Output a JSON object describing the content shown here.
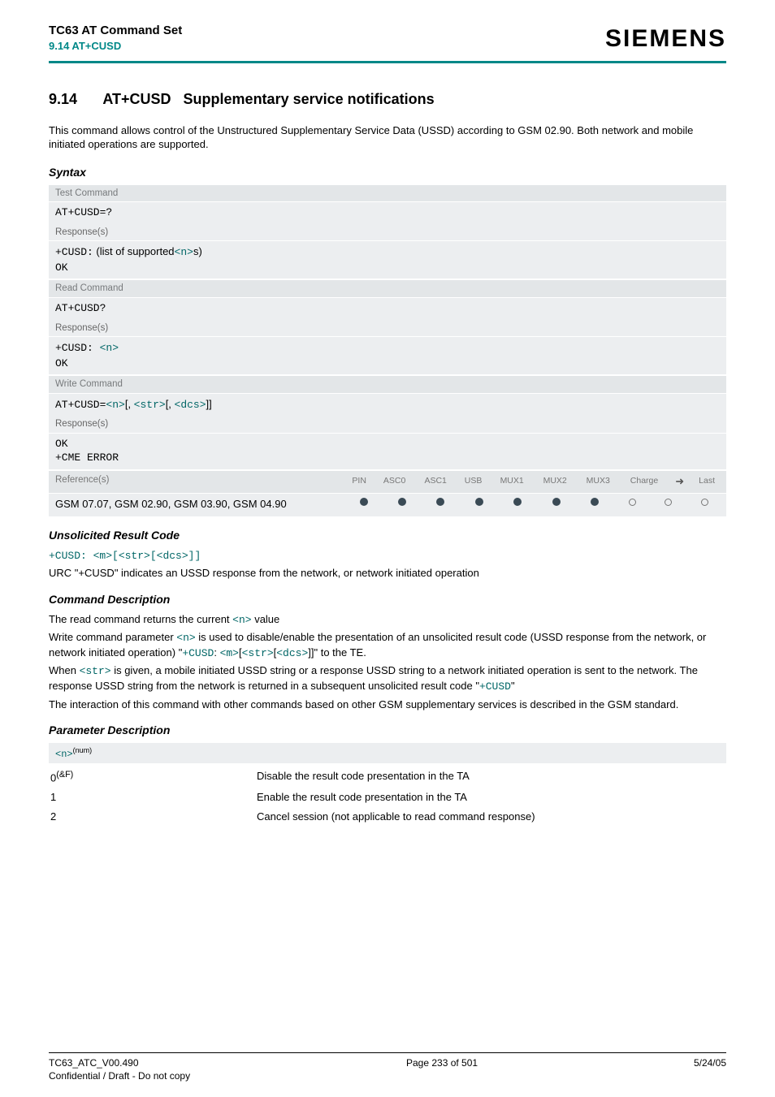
{
  "header": {
    "doc_title": "TC63 AT Command Set",
    "section_ref": "9.14 AT+CUSD",
    "logo": "SIEMENS"
  },
  "section": {
    "number": "9.14",
    "cmd": "AT+CUSD",
    "title": "Supplementary service notifications",
    "intro": "This command allows control of the Unstructured Supplementary Service Data (USSD) according to GSM 02.90. Both network and mobile initiated operations are supported."
  },
  "syntax_label": "Syntax",
  "syntax": {
    "test": {
      "label": "Test Command",
      "command": "AT+CUSD=?",
      "resp_label": "Response(s)",
      "resp_prefix": "+CUSD:",
      "resp_text_a": " (list of supported",
      "resp_n": "<n>",
      "resp_text_b": "s)",
      "ok": "OK"
    },
    "read": {
      "label": "Read Command",
      "command": "AT+CUSD?",
      "resp_label": "Response(s)",
      "resp_prefix": "+CUSD: ",
      "resp_n": "<n>",
      "ok": "OK"
    },
    "write": {
      "label": "Write Command",
      "cmd_prefix": "AT+CUSD=",
      "n": "<n>",
      "b1": "[, ",
      "str": "<str>",
      "b2": "[, ",
      "dcs": "<dcs>",
      "b3": "]]",
      "resp_label": "Response(s)",
      "ok": "OK",
      "err": "+CME ERROR"
    },
    "ref": {
      "label": "Reference(s)",
      "text": "GSM 07.07, GSM 02.90, GSM 03.90, GSM 04.90",
      "caps": [
        "PIN",
        "ASC0",
        "ASC1",
        "USB",
        "MUX1",
        "MUX2",
        "MUX3",
        "Charge",
        "➜",
        "Last"
      ],
      "vals": [
        "solid",
        "solid",
        "solid",
        "solid",
        "solid",
        "solid",
        "solid",
        "open",
        "open",
        "open"
      ]
    }
  },
  "urc": {
    "heading": "Unsolicited Result Code",
    "prefix": "+CUSD: ",
    "m": "<m>",
    "b1": "[",
    "str": "<str>",
    "b2": "[",
    "dcs": "<dcs>",
    "b3": "]]",
    "desc": "URC \"+CUSD\" indicates an USSD response from the network, or network initiated operation"
  },
  "cmd_desc": {
    "heading": "Command Description",
    "p1a": "The read command returns the current ",
    "p1_n": "<n>",
    "p1b": " value",
    "p2a": "Write command parameter ",
    "p2_n": "<n>",
    "p2b": " is used to disable/enable the presentation of an unsolicited result code (USSD response from the network, or network initiated operation) \"",
    "p2_c": "+CUSD",
    "p2c": ": ",
    "p2_m": "<m>",
    "p2_br1": "[",
    "p2_str": "<str>",
    "p2_br2": "[",
    "p2_dcs": "<dcs>",
    "p2_br3": "]]\" to the TE.",
    "p3a": "When ",
    "p3_str": "<str>",
    "p3b": " is given, a mobile initiated USSD string or a response USSD string to a network initiated operation is sent to the network. The response USSD string from the network is returned in a subsequent unsolicited result code \"",
    "p3_c": "+CUSD",
    "p3c": "\"",
    "p4": "The interaction of this command with other commands based on other GSM supplementary services is described in the GSM standard."
  },
  "param": {
    "heading": "Parameter Description",
    "name": "<n>",
    "type": "(num)",
    "rows": [
      {
        "val": "0",
        "sup": "(&F)",
        "desc": "Disable the result code presentation in the TA"
      },
      {
        "val": "1",
        "sup": "",
        "desc": "Enable the result code presentation in the TA"
      },
      {
        "val": "2",
        "sup": "",
        "desc": "Cancel session (not applicable to read command response)"
      }
    ]
  },
  "footer": {
    "version": "TC63_ATC_V00.490",
    "conf": "Confidential / Draft - Do not copy",
    "page": "Page 233 of 501",
    "date": "5/24/05"
  }
}
